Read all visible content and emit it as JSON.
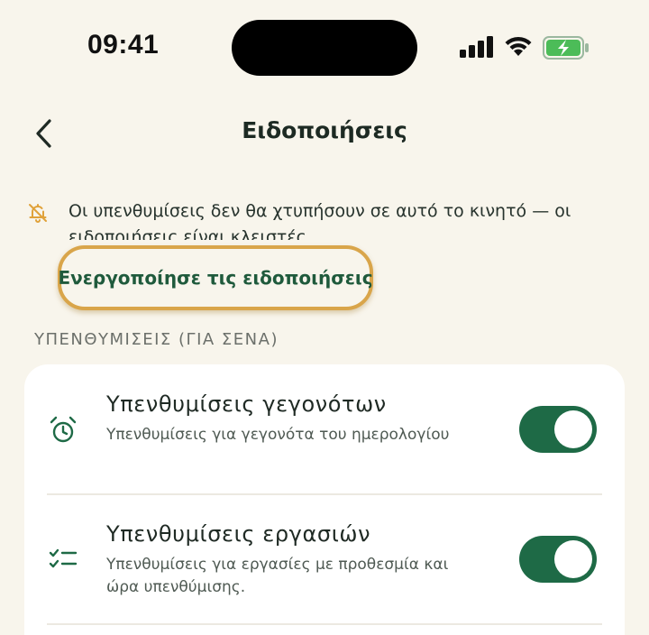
{
  "status_bar": {
    "time": "09:41"
  },
  "nav": {
    "title": "Ειδοποιήσεις"
  },
  "banner": {
    "text": "Οι υπενθυμίσεις δεν θα χτυπήσουν σε αυτό το κινητό — οι ειδοποιήσεις είναι κλειστές.",
    "action_label": "Ενεργοποίησε τις ειδοποιήσεις",
    "icon": "bell-off-icon",
    "icon_color": "#e0a23a"
  },
  "section": {
    "header": "ΥΠΕΝΘΥΜΙΣΕΙΣ (ΓΙΑ ΣΕΝΑ)"
  },
  "settings": [
    {
      "title": "Υπενθυμίσεις γεγονότων",
      "subtitle": "Υπενθυμίσεις για γεγονότα του ημερολογίου",
      "icon": "alarm-clock-icon",
      "enabled": true
    },
    {
      "title": "Υπενθυμίσεις εργασιών",
      "subtitle": "Υπενθυμίσεις για εργασίες με προθεσμία και ώρα υπενθύμισης.",
      "icon": "checklist-icon",
      "enabled": true
    }
  ],
  "colors": {
    "background": "#f8f5ec",
    "accent": "#1e6a46",
    "highlight": "#d9a54a"
  }
}
